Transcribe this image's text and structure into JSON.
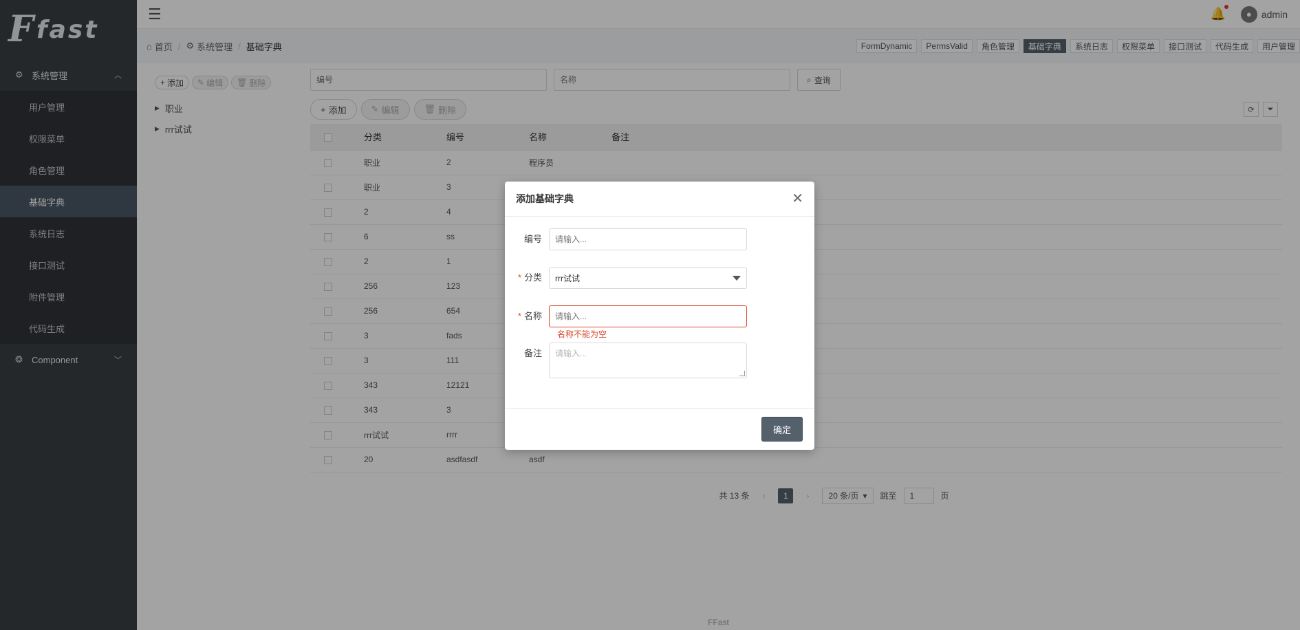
{
  "logo": {
    "mark": "F",
    "word": "fast"
  },
  "sidebar": {
    "group1": {
      "label": "系统管理",
      "icon": "gear-icon"
    },
    "items": [
      {
        "label": "用户管理",
        "active": false
      },
      {
        "label": "权限菜单",
        "active": false
      },
      {
        "label": "角色管理",
        "active": false
      },
      {
        "label": "基础字典",
        "active": true
      },
      {
        "label": "系统日志",
        "active": false
      },
      {
        "label": "接口测试",
        "active": false
      },
      {
        "label": "附件管理",
        "active": false
      },
      {
        "label": "代码生成",
        "active": false
      }
    ],
    "group2": {
      "label": "Component",
      "icon": "component-icon"
    }
  },
  "topbar": {
    "username": "admin"
  },
  "breadcrumb": {
    "home": "首页",
    "parent": "系统管理",
    "current": "基础字典"
  },
  "tabs": [
    "FormDynamic",
    "PermsValid",
    "角色管理",
    "基础字典",
    "系统日志",
    "权限菜单",
    "接口测试",
    "代码生成",
    "用户管理"
  ],
  "active_tab": "基础字典",
  "tree_toolbar": {
    "add": "添加",
    "edit": "编辑",
    "delete": "删除"
  },
  "tree": [
    "职业",
    "rrr试试"
  ],
  "search": {
    "code_placeholder": "编号",
    "name_placeholder": "名称",
    "query": "查询"
  },
  "table_toolbar": {
    "add": "添加",
    "edit": "编辑",
    "delete": "删除"
  },
  "table": {
    "headers": {
      "category": "分类",
      "code": "编号",
      "name": "名称",
      "remark": "备注"
    },
    "rows": [
      {
        "category": "职业",
        "code": "2",
        "name": "程序员",
        "remark": ""
      },
      {
        "category": "职业",
        "code": "3",
        "name": "",
        "remark": ""
      },
      {
        "category": "2",
        "code": "4",
        "name": "",
        "remark": ""
      },
      {
        "category": "6",
        "code": "ss",
        "name": "",
        "remark": ""
      },
      {
        "category": "2",
        "code": "1",
        "name": "",
        "remark": ""
      },
      {
        "category": "256",
        "code": "123",
        "name": "",
        "remark": ""
      },
      {
        "category": "256",
        "code": "654",
        "name": "",
        "remark": ""
      },
      {
        "category": "3",
        "code": "fads",
        "name": "",
        "remark": ""
      },
      {
        "category": "3",
        "code": "111",
        "name": "",
        "remark": ""
      },
      {
        "category": "343",
        "code": "12121",
        "name": "",
        "remark": ""
      },
      {
        "category": "343",
        "code": "3",
        "name": "",
        "remark": ""
      },
      {
        "category": "rrr试试",
        "code": "rrrr",
        "name": "",
        "remark": ""
      },
      {
        "category": "20",
        "code": "asdfasdf",
        "name": "asdf",
        "remark": ""
      }
    ]
  },
  "pager": {
    "total": "共 13 条",
    "current_page": "1",
    "page_size": "20 条/页",
    "jump_label": "跳至",
    "jump_value": "1",
    "page_suffix": "页"
  },
  "footer": "FFast",
  "modal": {
    "title": "添加基础字典",
    "code_label": "编号",
    "code_placeholder": "请输入...",
    "category_label": "分类",
    "category_value": "rrr试试",
    "name_label": "名称",
    "name_placeholder": "请输入...",
    "name_error": "名称不能为空",
    "remark_label": "备注",
    "remark_placeholder": "请输入...",
    "ok": "确定",
    "required_mark": "*"
  },
  "colors": {
    "sidebar": "#3a3f44",
    "active": "#55606d",
    "error": "#d84a2e"
  }
}
